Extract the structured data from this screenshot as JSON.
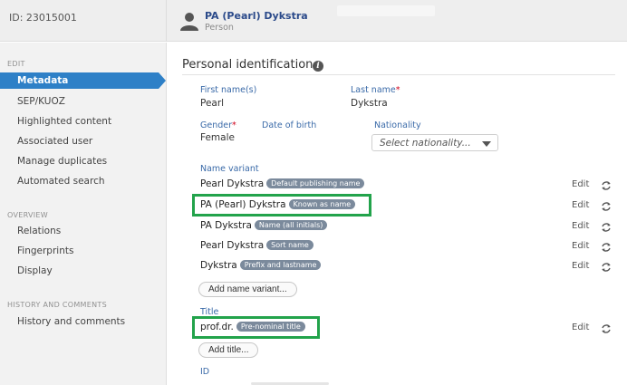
{
  "header": {
    "id_label": "ID: 23015001",
    "person_name": "PA (Pearl) Dykstra",
    "person_type": "Person"
  },
  "sidebar": {
    "sections": [
      {
        "label": "EDIT"
      },
      {
        "label": "OVERVIEW"
      },
      {
        "label": "HISTORY AND COMMENTS"
      }
    ],
    "active_item": "Metadata",
    "items": [
      {
        "label": "SEP/KUOZ"
      },
      {
        "label": "Highlighted content"
      },
      {
        "label": "Associated user"
      },
      {
        "label": "Manage duplicates"
      },
      {
        "label": "Automated search"
      },
      {
        "label": "Relations"
      },
      {
        "label": "Fingerprints"
      },
      {
        "label": "Display"
      },
      {
        "label": "History and comments"
      }
    ]
  },
  "main": {
    "section_title": "Personal identification",
    "info_icon": "i",
    "first_name": {
      "label": "First name(s)",
      "value": "Pearl"
    },
    "last_name": {
      "label": "Last name",
      "required": "*",
      "value": "Dykstra"
    },
    "gender": {
      "label": "Gender",
      "required": "*",
      "value": "Female"
    },
    "date_of_birth": {
      "label": "Date of birth"
    },
    "nationality": {
      "label": "Nationality",
      "placeholder": "Select nationality..."
    },
    "name_variant_label": "Name variant",
    "name_variants": [
      {
        "name": "Pearl Dykstra",
        "tag": "Default publishing name"
      },
      {
        "name": "PA (Pearl) Dykstra",
        "tag": "Known as name"
      },
      {
        "name": "PA Dykstra",
        "tag": "Name (all initials)"
      },
      {
        "name": "Pearl Dykstra",
        "tag": "Sort name"
      },
      {
        "name": "Dykstra",
        "tag": "Prefix and lastname"
      }
    ],
    "edit_label": "Edit",
    "add_name_variant": "Add name variant...",
    "title_label": "Title",
    "title_value": {
      "name": "prof.dr.",
      "tag": "Pre-nominal title"
    },
    "add_title": "Add title...",
    "id_label": "ID"
  },
  "colors": {
    "accent": "#2e80c7",
    "highlight": "#22a34b",
    "tag": "#7b8a9c",
    "required": "#d0021b"
  },
  "icons": {
    "person": "person-icon",
    "refresh": "refresh-icon",
    "info": "info-icon",
    "dropdown": "chevron-down-icon"
  }
}
